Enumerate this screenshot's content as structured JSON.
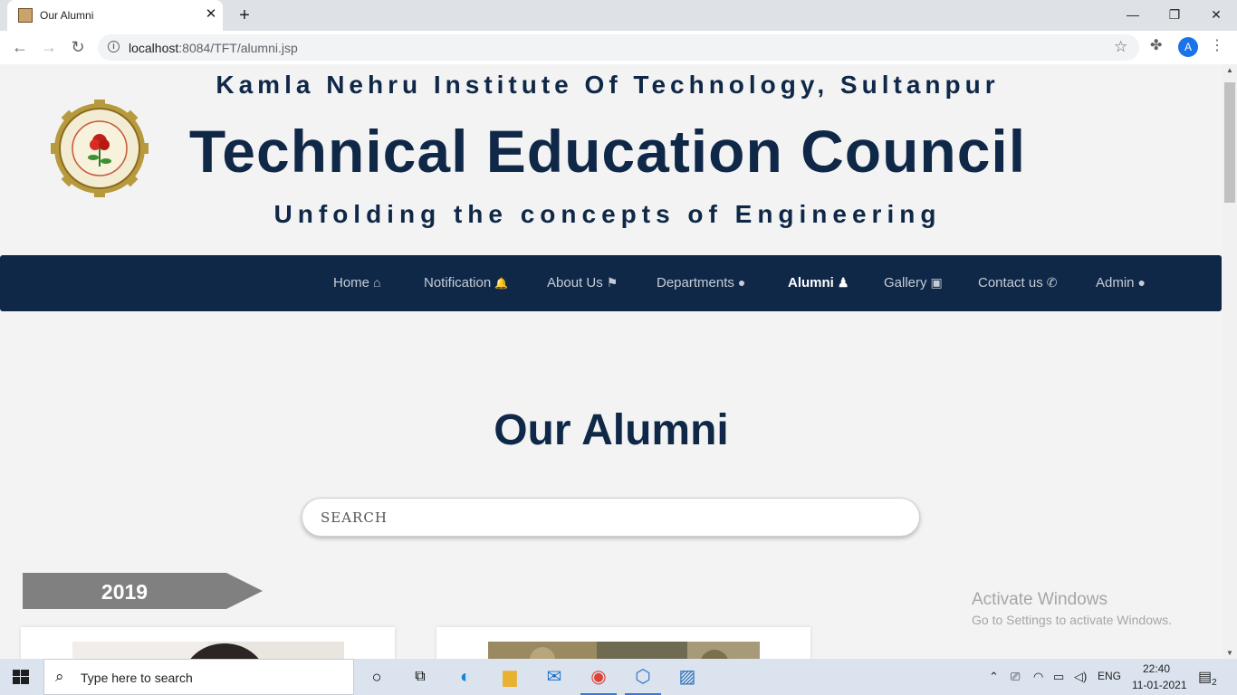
{
  "browser": {
    "tab_title": "Our Alumni",
    "tab_close": "✕",
    "new_tab": "+",
    "url_host": "localhost",
    "url_rest": ":8084/TFT/alumni.jsp",
    "avatar_letter": "A",
    "window_controls": {
      "minimize": "—",
      "restore": "❐",
      "close": "✕"
    }
  },
  "header": {
    "institute": "Kamla Nehru Institute Of Technology, Sultanpur",
    "council": "Technical Education Council",
    "tagline": "Unfolding the concepts of Engineering"
  },
  "nav": {
    "items": [
      {
        "label": "Home",
        "icon": "home-icon",
        "glyph": "⌂"
      },
      {
        "label": "Notification",
        "icon": "bell-icon",
        "glyph": "🔔"
      },
      {
        "label": "About Us",
        "icon": "flag-icon",
        "glyph": "⚑"
      },
      {
        "label": "Departments",
        "icon": "info-circle-icon",
        "glyph": "●"
      },
      {
        "label": "Alumni",
        "icon": "graduate-icon",
        "glyph": "♟",
        "active": true
      },
      {
        "label": "Gallery",
        "icon": "image-icon",
        "glyph": "▣"
      },
      {
        "label": "Contact us",
        "icon": "phone-icon",
        "glyph": "✆"
      },
      {
        "label": "Admin",
        "icon": "user-icon",
        "glyph": "●"
      }
    ]
  },
  "main": {
    "title": "Our Alumni",
    "search_placeholder": "SEARCH",
    "year": "2019"
  },
  "watermark": {
    "line1": "Activate Windows",
    "line2": "Go to Settings to activate Windows."
  },
  "taskbar": {
    "search_placeholder": "Type here to search",
    "language": "ENG",
    "time": "22:40",
    "date": "11-01-2021",
    "notification_count": "2"
  },
  "colors": {
    "brand_navy": "#0f2848",
    "banner_gray": "#808080",
    "page_bg": "#f3f3f3"
  }
}
